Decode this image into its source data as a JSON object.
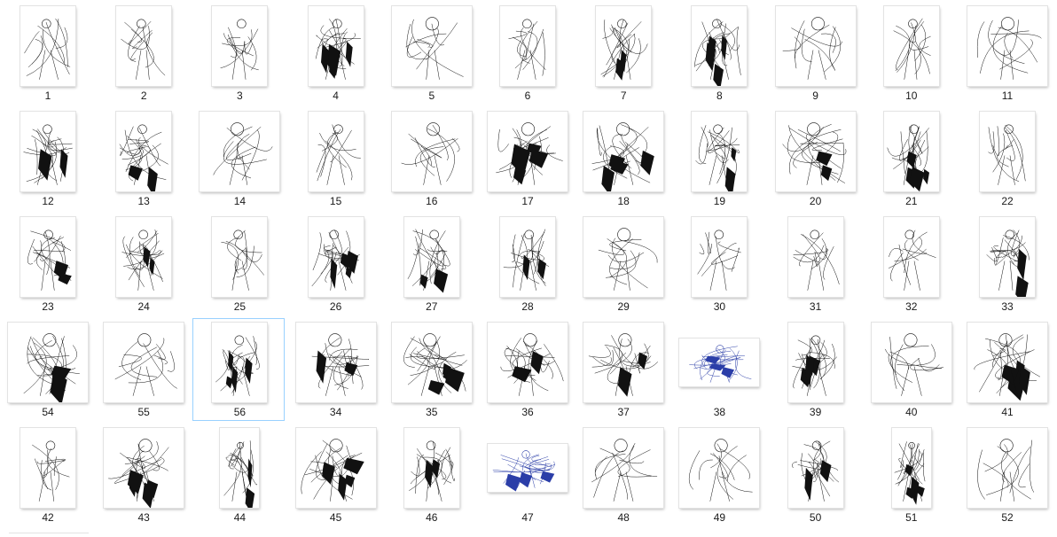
{
  "explorer": {
    "selected_label": "56",
    "items": [
      {
        "label": "1",
        "orientation": "portrait",
        "ink": "light"
      },
      {
        "label": "2",
        "orientation": "portrait",
        "ink": "light"
      },
      {
        "label": "3",
        "orientation": "portrait",
        "ink": "light"
      },
      {
        "label": "4",
        "orientation": "portrait",
        "ink": "heavy"
      },
      {
        "label": "5",
        "orientation": "landscape",
        "ink": "light"
      },
      {
        "label": "6",
        "orientation": "portrait",
        "ink": "light"
      },
      {
        "label": "7",
        "orientation": "portrait",
        "ink": "medium"
      },
      {
        "label": "8",
        "orientation": "portrait",
        "ink": "heavy"
      },
      {
        "label": "9",
        "orientation": "landscape",
        "ink": "light"
      },
      {
        "label": "10",
        "orientation": "portrait",
        "ink": "light"
      },
      {
        "label": "11",
        "orientation": "landscape",
        "ink": "light"
      },
      {
        "label": "12",
        "orientation": "portrait",
        "ink": "medium"
      },
      {
        "label": "13",
        "orientation": "portrait",
        "ink": "medium"
      },
      {
        "label": "14",
        "orientation": "landscape",
        "ink": "light"
      },
      {
        "label": "15",
        "orientation": "portrait",
        "ink": "light"
      },
      {
        "label": "16",
        "orientation": "landscape",
        "ink": "light"
      },
      {
        "label": "17",
        "orientation": "landscape",
        "ink": "heavy"
      },
      {
        "label": "18",
        "orientation": "landscape",
        "ink": "heavy"
      },
      {
        "label": "19",
        "orientation": "portrait",
        "ink": "medium"
      },
      {
        "label": "20",
        "orientation": "landscape",
        "ink": "medium"
      },
      {
        "label": "21",
        "orientation": "portrait",
        "ink": "heavy"
      },
      {
        "label": "22",
        "orientation": "portrait",
        "ink": "light"
      },
      {
        "label": "23",
        "orientation": "portrait",
        "ink": "medium"
      },
      {
        "label": "24",
        "orientation": "portrait",
        "ink": "medium"
      },
      {
        "label": "25",
        "orientation": "portrait",
        "ink": "light"
      },
      {
        "label": "26",
        "orientation": "portrait",
        "ink": "heavy"
      },
      {
        "label": "27",
        "orientation": "portrait",
        "ink": "medium"
      },
      {
        "label": "28",
        "orientation": "portrait",
        "ink": "medium"
      },
      {
        "label": "29",
        "orientation": "landscape",
        "ink": "light"
      },
      {
        "label": "30",
        "orientation": "portrait",
        "ink": "light"
      },
      {
        "label": "31",
        "orientation": "portrait",
        "ink": "light"
      },
      {
        "label": "32",
        "orientation": "portrait",
        "ink": "light"
      },
      {
        "label": "33",
        "orientation": "portrait",
        "ink": "medium"
      },
      {
        "label": "54",
        "orientation": "landscape",
        "ink": "medium"
      },
      {
        "label": "55",
        "orientation": "landscape",
        "ink": "light"
      },
      {
        "label": "56",
        "orientation": "portrait",
        "ink": "heavy"
      },
      {
        "label": "34",
        "orientation": "landscape",
        "ink": "medium"
      },
      {
        "label": "35",
        "orientation": "landscape",
        "ink": "heavy"
      },
      {
        "label": "36",
        "orientation": "landscape",
        "ink": "medium"
      },
      {
        "label": "37",
        "orientation": "landscape",
        "ink": "medium"
      },
      {
        "label": "38",
        "orientation": "wide",
        "ink": "blue"
      },
      {
        "label": "39",
        "orientation": "portrait",
        "ink": "heavy"
      },
      {
        "label": "40",
        "orientation": "landscape",
        "ink": "light"
      },
      {
        "label": "41",
        "orientation": "landscape",
        "ink": "heavy"
      },
      {
        "label": "42",
        "orientation": "portrait",
        "ink": "light"
      },
      {
        "label": "43",
        "orientation": "landscape",
        "ink": "heavy"
      },
      {
        "label": "44",
        "orientation": "narrow",
        "ink": "medium"
      },
      {
        "label": "45",
        "orientation": "landscape",
        "ink": "heavy"
      },
      {
        "label": "46",
        "orientation": "portrait",
        "ink": "medium"
      },
      {
        "label": "47",
        "orientation": "wide",
        "ink": "blue"
      },
      {
        "label": "48",
        "orientation": "landscape",
        "ink": "light"
      },
      {
        "label": "49",
        "orientation": "landscape",
        "ink": "light"
      },
      {
        "label": "50",
        "orientation": "portrait",
        "ink": "medium"
      },
      {
        "label": "51",
        "orientation": "narrow",
        "ink": "heavy"
      },
      {
        "label": "52",
        "orientation": "landscape",
        "ink": "light"
      }
    ]
  },
  "colors": {
    "selection_border": "#99d1ff",
    "label_text": "#1a1a1a",
    "ink_black": "#111111",
    "ink_blue": "#2b3ea8"
  }
}
